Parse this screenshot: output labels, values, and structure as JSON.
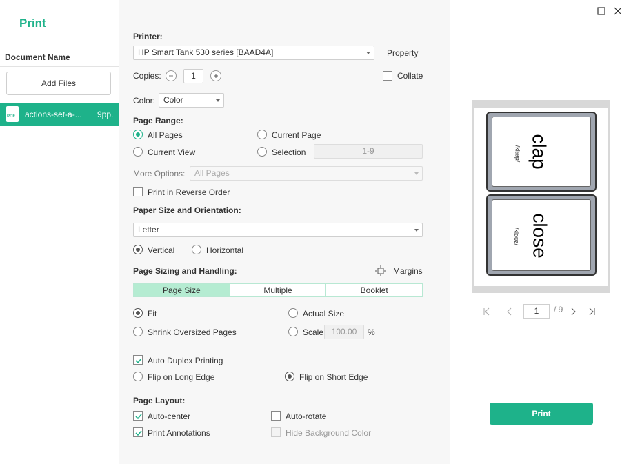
{
  "app": {
    "title": "Print"
  },
  "sidebar": {
    "heading": "Document Name",
    "add_files": "Add Files",
    "files": [
      {
        "name": "actions-set-a-...",
        "pages": "9pp.",
        "icon": "pdf-icon",
        "icon_text": "PDF"
      }
    ]
  },
  "printer": {
    "label": "Printer:",
    "value": "HP Smart Tank 530 series [BAAD4A]",
    "property": "Property"
  },
  "copies": {
    "label": "Copies:",
    "value": "1",
    "collate": "Collate"
  },
  "color": {
    "label": "Color:",
    "value": "Color"
  },
  "page_range": {
    "label": "Page Range:",
    "all_pages": "All Pages",
    "current_page": "Current Page",
    "current_view": "Current View",
    "selection": "Selection",
    "selection_value": "1-9",
    "selected": "All Pages"
  },
  "more_options": {
    "label": "More Options:",
    "value": "All Pages"
  },
  "reverse": {
    "label": "Print in Reverse Order",
    "checked": false
  },
  "paper": {
    "label": "Paper Size and Orientation:",
    "size": "Letter",
    "vertical": "Vertical",
    "horizontal": "Horizontal",
    "orientation": "Vertical"
  },
  "sizing": {
    "label": "Page Sizing and Handling:",
    "margins": "Margins",
    "tabs": [
      "Page Size",
      "Multiple",
      "Booklet"
    ],
    "active_tab": "Page Size",
    "fit": "Fit",
    "actual_size": "Actual Size",
    "shrink": "Shrink Oversized Pages",
    "scale": "Scale",
    "scale_value": "100.00",
    "percent": "%",
    "selected": "Fit"
  },
  "duplex": {
    "auto": "Auto Duplex Printing",
    "auto_checked": true,
    "long_edge": "Flip on Long Edge",
    "short_edge": "Flip on Short Edge",
    "selected": "Flip on Short Edge"
  },
  "layout": {
    "label": "Page Layout:",
    "auto_center": "Auto-center",
    "auto_center_checked": true,
    "auto_rotate": "Auto-rotate",
    "auto_rotate_checked": false,
    "print_annotations": "Print Annotations",
    "print_annotations_checked": true,
    "hide_bg": "Hide Background Color",
    "hide_bg_checked": false
  },
  "preview": {
    "cards": [
      {
        "word": "clap",
        "phonetic": "/klæp/"
      },
      {
        "word": "close",
        "phonetic": "/kloʊz/"
      }
    ],
    "page_current": "1",
    "page_total": "/ 9"
  },
  "print_button": "Print",
  "colors": {
    "accent": "#1eb28a",
    "tab_active": "#b5ecd2"
  }
}
